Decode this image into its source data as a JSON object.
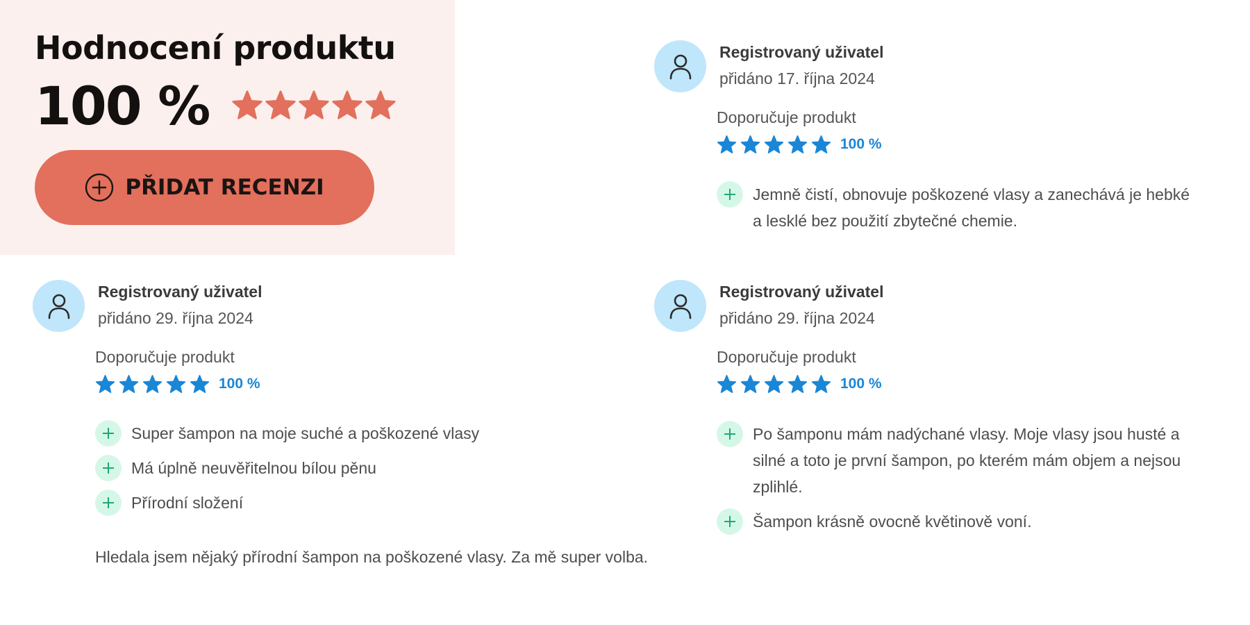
{
  "summary": {
    "title": "Hodnocení produktu",
    "score": "100 %",
    "stars": 5,
    "star_color": "#e2705c",
    "add_review_label": "PŘIDAT RECENZI",
    "add_review_icon": "plus-circle-icon",
    "panel_bg": "#fbf0ee",
    "button_color": "#e2705c"
  },
  "reviews": [
    {
      "author": "Registrovaný uživatel",
      "date": "přidáno 17. října 2024",
      "recommends": "Doporučuje produkt",
      "stars": 5,
      "rating": "100 %",
      "pros": [
        "Jemně čistí, obnovuje poškozené vlasy a zanechává je hebké a lesklé bez použití zbytečné chemie."
      ],
      "comment": ""
    },
    {
      "author": "Registrovaný uživatel",
      "date": "přidáno 29. října 2024",
      "recommends": "Doporučuje produkt",
      "stars": 5,
      "rating": "100 %",
      "pros": [
        "Super šampon na moje suché a poškozené vlasy",
        "Má úplně neuvěřitelnou bílou pěnu",
        "Přírodní složení"
      ],
      "comment": "Hledala jsem nějaký přírodní šampon na poškozené vlasy. Za mě super volba."
    },
    {
      "author": "Registrovaný uživatel",
      "date": "přidáno 29. října 2024",
      "recommends": "Doporučuje produkt",
      "stars": 5,
      "rating": "100 %",
      "pros": [
        "Po šamponu mám nadýchané vlasy. Moje vlasy jsou husté a silné a toto je první šampon, po kterém mám objem a nejsou zplihlé.",
        "Šampon krásně ovocně květinově voní."
      ],
      "comment": ""
    }
  ],
  "colors": {
    "avatar_bg": "#bfe6fb",
    "rating_blue": "#1a86d6",
    "pro_icon_bg": "#d5f7e8",
    "pro_icon_fg": "#1fa874"
  },
  "icons": {
    "avatar": "user-icon",
    "pro": "plus-icon",
    "star": "star-icon"
  }
}
